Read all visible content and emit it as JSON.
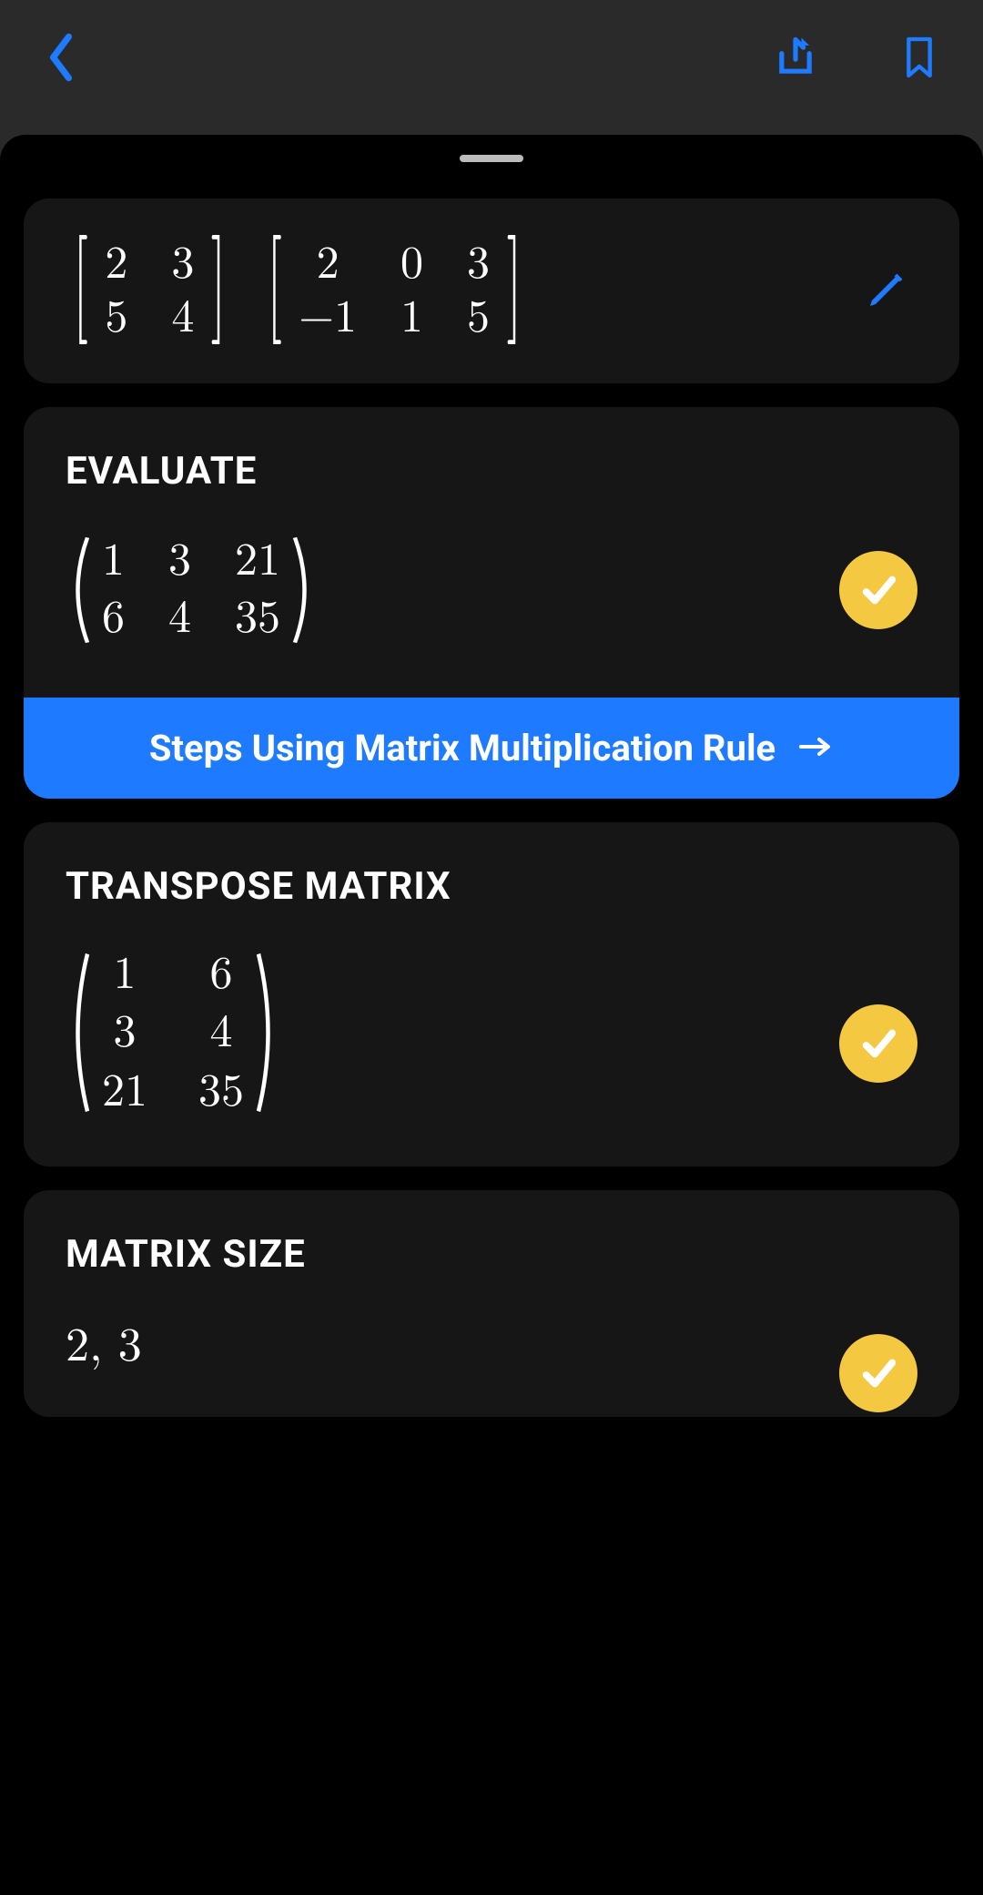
{
  "colors": {
    "accent": "#1e7bff",
    "badge": "#f5c842"
  },
  "input": {
    "matrix_a": [
      [
        "2",
        "3"
      ],
      [
        "5",
        "4"
      ]
    ],
    "matrix_b": [
      [
        "2",
        "0",
        "3"
      ],
      [
        "−1",
        "1",
        "5"
      ]
    ]
  },
  "evaluate": {
    "title": "EVALUATE",
    "result": [
      [
        "1",
        "3",
        "21"
      ],
      [
        "6",
        "4",
        "35"
      ]
    ],
    "steps_label": "Steps Using Matrix Multiplication Rule"
  },
  "transpose": {
    "title": "TRANSPOSE MATRIX",
    "result": [
      [
        "1",
        "6"
      ],
      [
        "3",
        "4"
      ],
      [
        "21",
        "35"
      ]
    ]
  },
  "size": {
    "title": "MATRIX SIZE",
    "value": "2, 3"
  }
}
